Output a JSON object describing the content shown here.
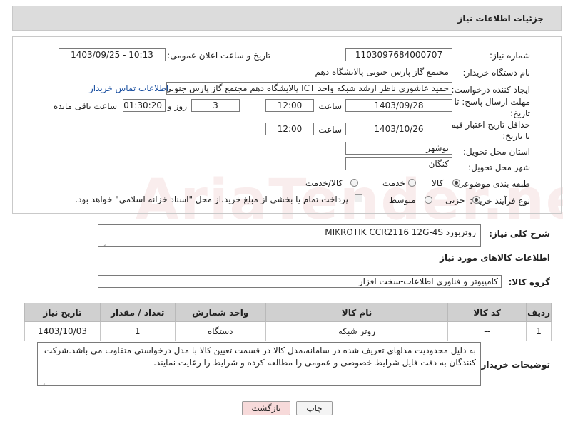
{
  "header": {
    "title": "جزئیات اطلاعات نیاز"
  },
  "watermark": "AriaTender.net",
  "form": {
    "need_number_label": "شماره نیاز:",
    "need_number": "1103097684000707",
    "announce_label": "تاریخ و ساعت اعلان عمومی:",
    "announce_value": "1403/09/25 - 10:13",
    "buyer_org_label": "نام دستگاه خریدار:",
    "buyer_org": "مجتمع گاز پارس جنوبی  پالایشگاه دهم",
    "creator_label": "ایجاد کننده درخواست:",
    "creator": "حمید عاشوری ناظر ارشد شبکه واحد ICT پالایشگاه دهم مجتمع گاز پارس جنوبی",
    "contact_link": "اطلاعات تماس خریدار",
    "reply_deadline_label": "مهلت ارسال پاسخ: تا تاریخ:",
    "reply_date": "1403/09/28",
    "time_label": "ساعت",
    "reply_time": "12:00",
    "days_value": "3",
    "days_label": "روز و",
    "remaining_time": "01:30:20",
    "remaining_label": "ساعت باقی مانده",
    "validity_label": "حداقل تاریخ اعتبار قیمت: تا تاریخ:",
    "validity_date": "1403/10/26",
    "validity_time": "12:00",
    "province_label": "استان محل تحویل:",
    "province": "بوشهر",
    "city_label": "شهر محل تحویل:",
    "city": "کنگان",
    "category_label": "طبقه بندی موضوعی:",
    "category_options": [
      "کالا",
      "خدمت",
      "کالا/خدمت"
    ],
    "category_selected": "کالا",
    "process_label": "نوع فرآیند خرید :",
    "process_options": [
      "جزیی",
      "متوسط"
    ],
    "process_selected": "جزیی",
    "payment_note": "پرداخت تمام یا بخشی از مبلغ خرید،از محل \"اسناد خزانه اسلامی\" خواهد بود."
  },
  "description": {
    "label": "شرح کلی نیاز:",
    "value": "روتربورد MIKROTIK CCR2116 12G-4S"
  },
  "goods_info_title": "اطلاعات کالاهای مورد نیاز",
  "goods_group": {
    "label": "گروه کالا:",
    "value": "کامپیوتر و فناوری اطلاعات-سخت افزار"
  },
  "table": {
    "headers": [
      "ردیف",
      "کد کالا",
      "نام کالا",
      "واحد شمارش",
      "تعداد / مقدار",
      "تاریخ نیاز"
    ],
    "rows": [
      [
        "1",
        "--",
        "روتر شبکه",
        "دستگاه",
        "1",
        "1403/10/03"
      ]
    ]
  },
  "buyer_notes": {
    "label": "توضیحات خریدار:",
    "value": "به دلیل محدودیت مدلهای تعریف شده در سامانه،مدل کالا در قسمت تعیین کالا با مدل درخواستی متفاوت می باشد.شرکت کنندگان به دقت فایل شرایط خصوصی و عمومی را مطالعه  کرده و شرایط را رعایت نمایند."
  },
  "buttons": {
    "print": "چاپ",
    "back": "بازگشت"
  },
  "colors": {
    "header_bg": "#dcdcdc",
    "table_header_bg": "#d0d0d0",
    "back_button_bg": "#f7dada",
    "link": "#1a4fa0"
  }
}
